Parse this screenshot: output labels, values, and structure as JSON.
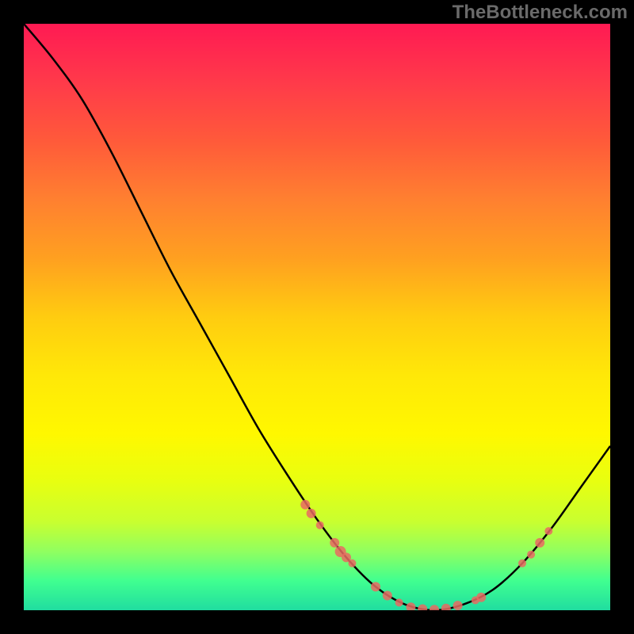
{
  "attribution": "TheBottleneck.com",
  "chart_data": {
    "type": "line",
    "title": "",
    "xlabel": "",
    "ylabel": "",
    "ylim": [
      0,
      100
    ],
    "xlim": [
      0,
      100
    ],
    "curve_points": [
      {
        "x": 0,
        "y": 100
      },
      {
        "x": 5,
        "y": 94
      },
      {
        "x": 10,
        "y": 87
      },
      {
        "x": 15,
        "y": 78
      },
      {
        "x": 20,
        "y": 68
      },
      {
        "x": 25,
        "y": 58
      },
      {
        "x": 30,
        "y": 49
      },
      {
        "x": 35,
        "y": 40
      },
      {
        "x": 40,
        "y": 31
      },
      {
        "x": 45,
        "y": 23
      },
      {
        "x": 50,
        "y": 15.5
      },
      {
        "x": 55,
        "y": 9
      },
      {
        "x": 60,
        "y": 4
      },
      {
        "x": 65,
        "y": 1
      },
      {
        "x": 70,
        "y": 0
      },
      {
        "x": 75,
        "y": 1
      },
      {
        "x": 80,
        "y": 3.5
      },
      {
        "x": 85,
        "y": 8
      },
      {
        "x": 90,
        "y": 14
      },
      {
        "x": 95,
        "y": 21
      },
      {
        "x": 100,
        "y": 28
      }
    ],
    "markers": [
      {
        "x": 48,
        "y": 18,
        "r": 6
      },
      {
        "x": 49,
        "y": 16.5,
        "r": 6
      },
      {
        "x": 50.5,
        "y": 14.5,
        "r": 5
      },
      {
        "x": 53,
        "y": 11.5,
        "r": 6
      },
      {
        "x": 54,
        "y": 10,
        "r": 7
      },
      {
        "x": 55,
        "y": 9,
        "r": 6
      },
      {
        "x": 56,
        "y": 8,
        "r": 5
      },
      {
        "x": 60,
        "y": 4,
        "r": 6
      },
      {
        "x": 62,
        "y": 2.5,
        "r": 6
      },
      {
        "x": 64,
        "y": 1.3,
        "r": 5
      },
      {
        "x": 66,
        "y": 0.5,
        "r": 6
      },
      {
        "x": 68,
        "y": 0.2,
        "r": 6
      },
      {
        "x": 70,
        "y": 0.1,
        "r": 6
      },
      {
        "x": 72,
        "y": 0.3,
        "r": 6
      },
      {
        "x": 74,
        "y": 0.8,
        "r": 6
      },
      {
        "x": 77,
        "y": 1.7,
        "r": 5
      },
      {
        "x": 78,
        "y": 2.2,
        "r": 6
      },
      {
        "x": 85,
        "y": 8,
        "r": 5
      },
      {
        "x": 86.5,
        "y": 9.5,
        "r": 5
      },
      {
        "x": 88,
        "y": 11.5,
        "r": 6
      },
      {
        "x": 89.5,
        "y": 13.5,
        "r": 5
      }
    ]
  }
}
